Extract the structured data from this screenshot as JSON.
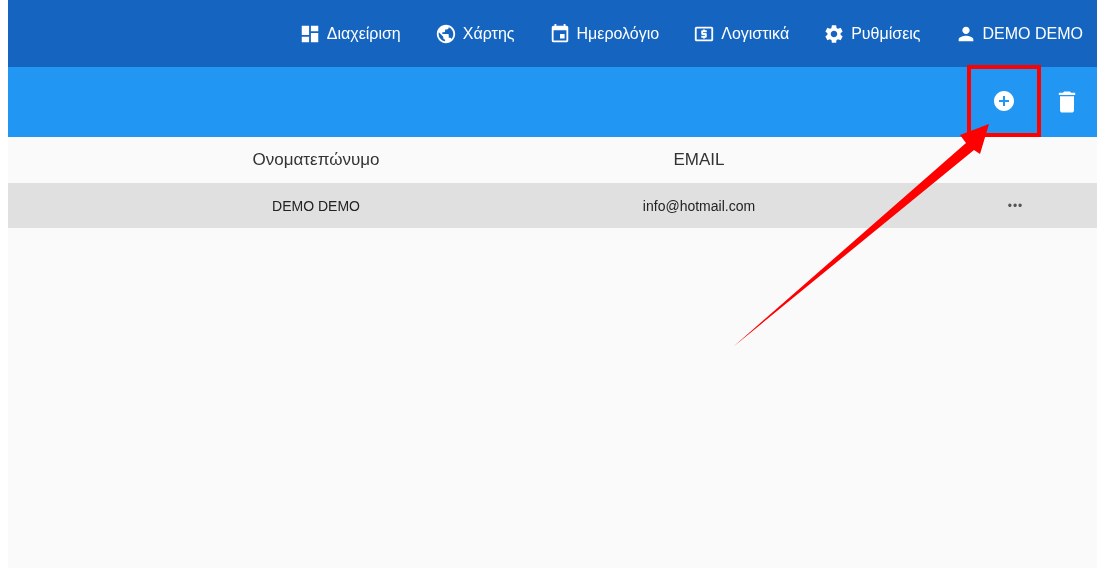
{
  "nav": [
    {
      "kind": "dashboard",
      "label": "Διαχείριση"
    },
    {
      "kind": "globe",
      "label": "Χάρτης"
    },
    {
      "kind": "calendar",
      "label": "Ημερολόγιο"
    },
    {
      "kind": "money",
      "label": "Λογιστικά"
    },
    {
      "kind": "gear",
      "label": "Ρυθμίσεις"
    },
    {
      "kind": "user",
      "label": "DEMO DEMO"
    }
  ],
  "toolbar": {
    "buttons": [
      {
        "kind": "add",
        "highlighted": true
      },
      {
        "kind": "delete",
        "highlighted": false
      }
    ]
  },
  "table": {
    "columns": [
      "Ονοματεπώνυμο",
      "EMAIL"
    ],
    "rows": [
      {
        "cells": [
          "DEMO DEMO",
          "info@hotmail.com"
        ],
        "menu": "•••"
      }
    ]
  },
  "annotation_arrow": true
}
